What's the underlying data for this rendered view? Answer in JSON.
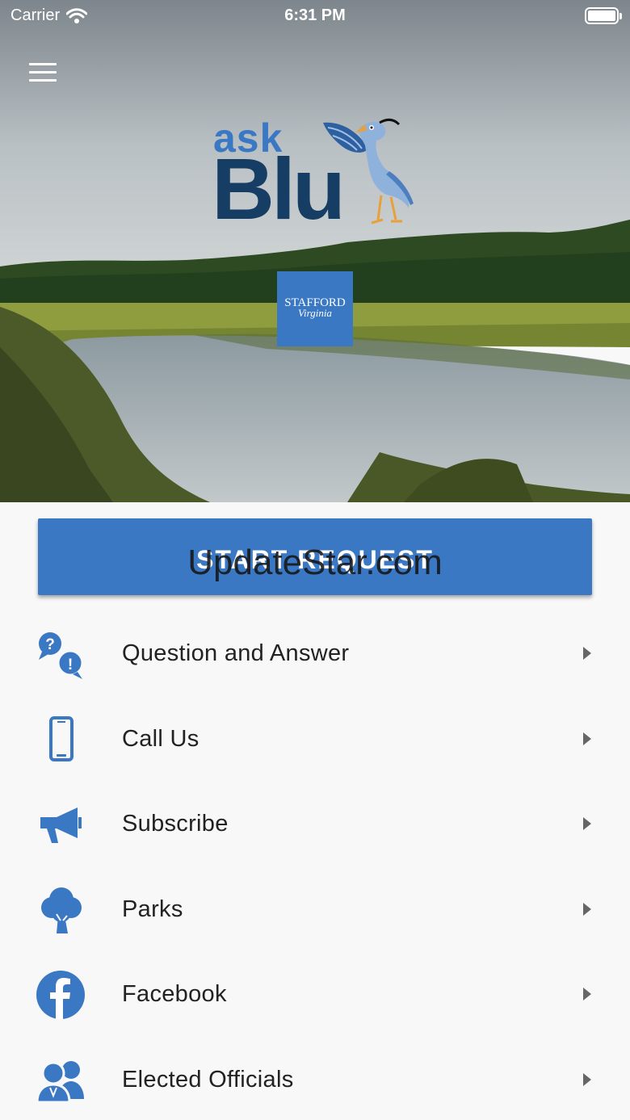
{
  "status_bar": {
    "carrier": "Carrier",
    "time": "6:31 PM"
  },
  "logo": {
    "ask": "ask",
    "blu": "Blu"
  },
  "badge": {
    "name": "STAFFORD",
    "state": "Virginia"
  },
  "start_request": {
    "label": "START REQUEST"
  },
  "watermark": "UpdateStar.com",
  "menu_items": [
    {
      "label": "Question and Answer",
      "icon": "question-answer-icon"
    },
    {
      "label": "Call Us",
      "icon": "phone-icon"
    },
    {
      "label": "Subscribe",
      "icon": "megaphone-icon"
    },
    {
      "label": "Parks",
      "icon": "tree-icon"
    },
    {
      "label": "Facebook",
      "icon": "facebook-icon"
    },
    {
      "label": "Elected Officials",
      "icon": "officials-icon"
    }
  ],
  "colors": {
    "accent": "#3a78c4",
    "logo_dark": "#163d64",
    "text": "#222222",
    "background": "#f8f8f8"
  }
}
